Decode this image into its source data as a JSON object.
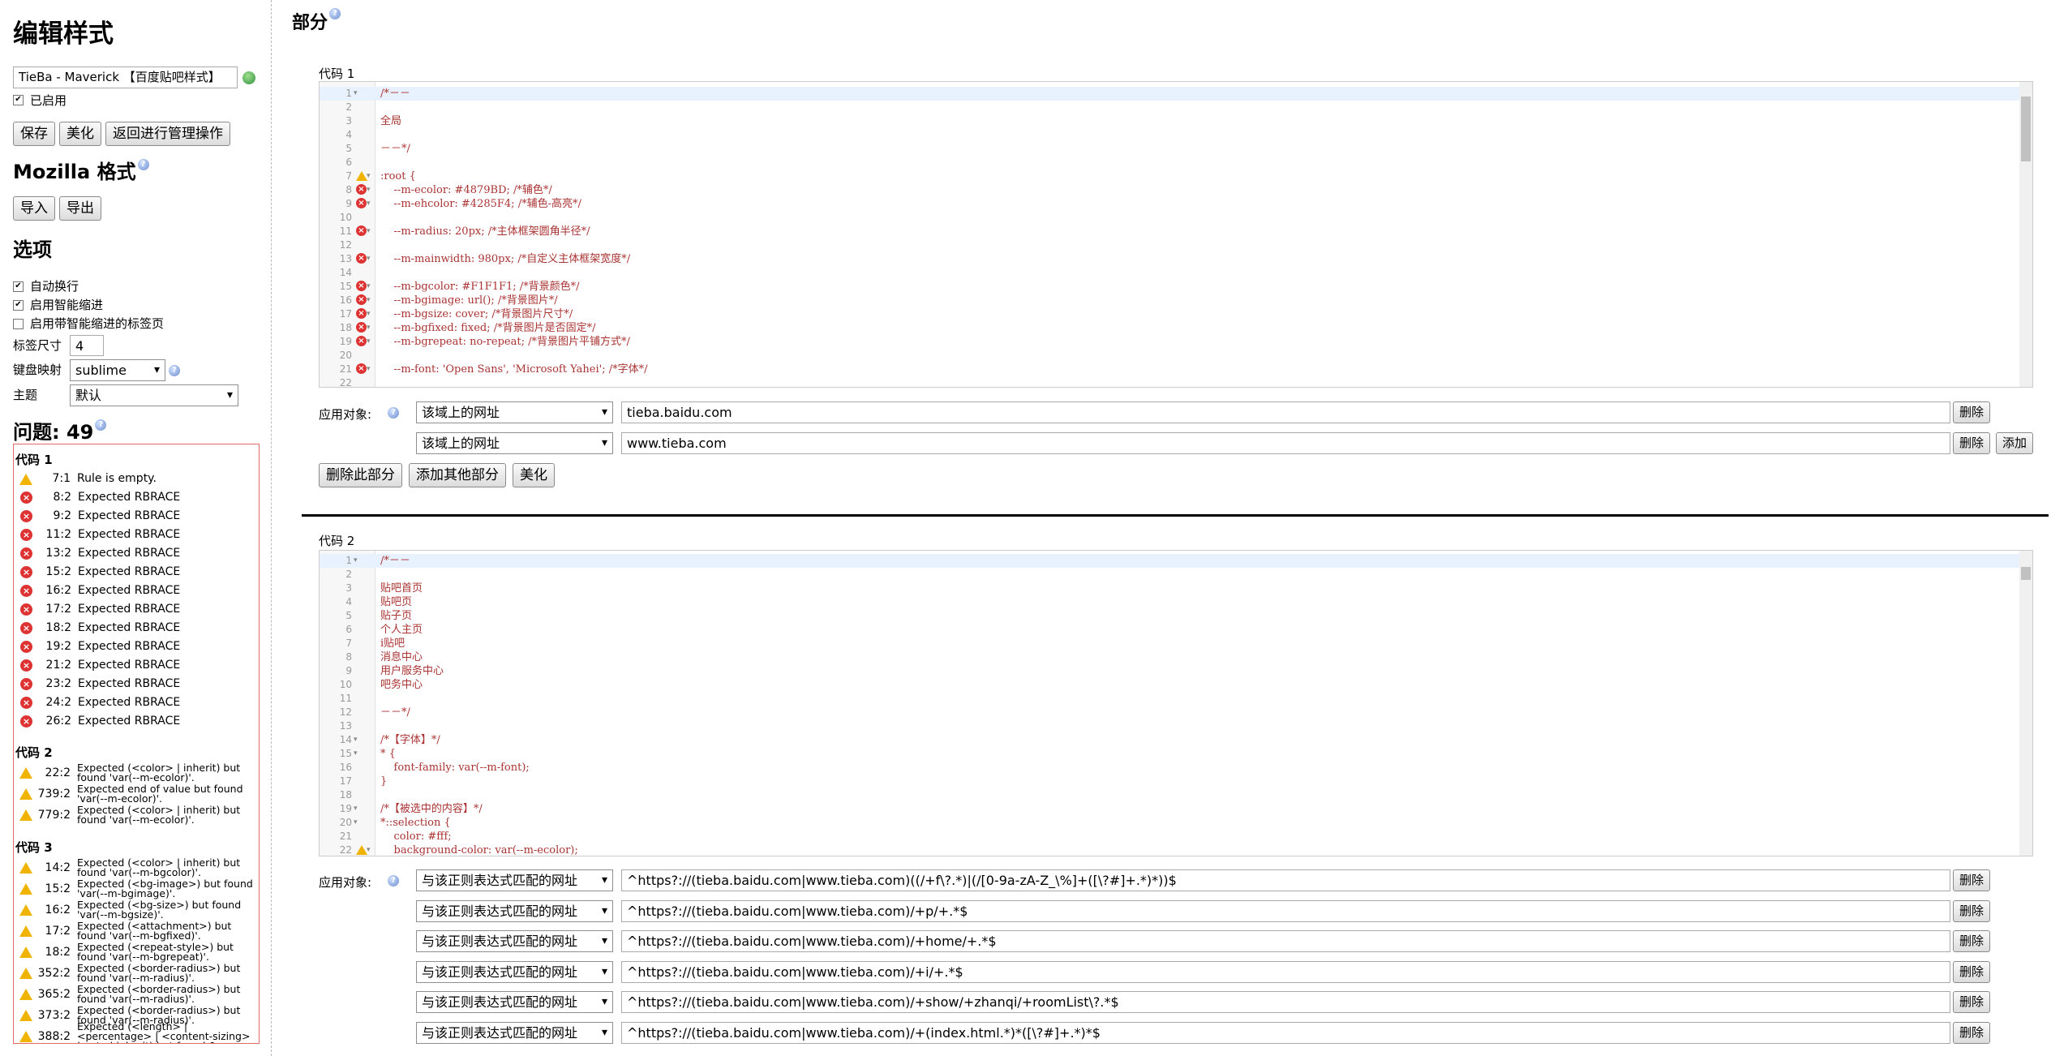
{
  "sidebar": {
    "title": "编辑样式",
    "style_name": "TieBa - Maverick 【百度贴吧样式】",
    "enabled_label": "已启用",
    "buttons": {
      "save": "保存",
      "beautify": "美化",
      "back": "返回进行管理操作"
    },
    "mozilla_heading": "Mozilla 格式",
    "import_label": "导入",
    "export_label": "导出",
    "options_heading": "选项",
    "options": {
      "wrap": "自动换行",
      "smart_indent": "启用智能缩进",
      "smart_indent_tabs": "启用带智能缩进的标签页",
      "tab_size_label": "标签尺寸",
      "tab_size_value": "4",
      "keymap_label": "键盘映射",
      "keymap_value": "sublime",
      "theme_label": "主题",
      "theme_value": "默认"
    },
    "issues_heading": "问题: 49",
    "issue_groups": [
      {
        "title": "代码 1",
        "items": [
          {
            "type": "warn",
            "loc": "7:1",
            "msg": "Rule is empty."
          },
          {
            "type": "err",
            "loc": "8:2",
            "msg": "Expected RBRACE"
          },
          {
            "type": "err",
            "loc": "9:2",
            "msg": "Expected RBRACE"
          },
          {
            "type": "err",
            "loc": "11:2",
            "msg": "Expected RBRACE"
          },
          {
            "type": "err",
            "loc": "13:2",
            "msg": "Expected RBRACE"
          },
          {
            "type": "err",
            "loc": "15:2",
            "msg": "Expected RBRACE"
          },
          {
            "type": "err",
            "loc": "16:2",
            "msg": "Expected RBRACE"
          },
          {
            "type": "err",
            "loc": "17:2",
            "msg": "Expected RBRACE"
          },
          {
            "type": "err",
            "loc": "18:2",
            "msg": "Expected RBRACE"
          },
          {
            "type": "err",
            "loc": "19:2",
            "msg": "Expected RBRACE"
          },
          {
            "type": "err",
            "loc": "21:2",
            "msg": "Expected RBRACE"
          },
          {
            "type": "err",
            "loc": "23:2",
            "msg": "Expected RBRACE"
          },
          {
            "type": "err",
            "loc": "24:2",
            "msg": "Expected RBRACE"
          },
          {
            "type": "err",
            "loc": "26:2",
            "msg": "Expected RBRACE"
          }
        ]
      },
      {
        "title": "代码 2",
        "items": [
          {
            "type": "warn",
            "loc": "22:2",
            "msg": "Expected (<color> | inherit) but found 'var(--m-ecolor)'."
          },
          {
            "type": "warn",
            "loc": "739:2",
            "msg": "Expected end of value but found 'var(--m-ecolor)'."
          },
          {
            "type": "warn",
            "loc": "779:2",
            "msg": "Expected (<color> | inherit) but found 'var(--m-ecolor)'."
          }
        ]
      },
      {
        "title": "代码 3",
        "items": [
          {
            "type": "warn",
            "loc": "14:2",
            "msg": "Expected (<color> | inherit) but found 'var(--m-bgcolor)'."
          },
          {
            "type": "warn",
            "loc": "15:2",
            "msg": "Expected (<bg-image>) but found 'var(--m-bgimage)'."
          },
          {
            "type": "warn",
            "loc": "16:2",
            "msg": "Expected (<bg-size>) but found 'var(--m-bgsize)'."
          },
          {
            "type": "warn",
            "loc": "17:2",
            "msg": "Expected (<attachment>) but found 'var(--m-bgfixed)'."
          },
          {
            "type": "warn",
            "loc": "18:2",
            "msg": "Expected (<repeat-style>) but found 'var(--m-bgrepeat)'."
          },
          {
            "type": "warn",
            "loc": "352:2",
            "msg": "Expected (<border-radius>) but found 'var(--m-radius)'."
          },
          {
            "type": "warn",
            "loc": "365:2",
            "msg": "Expected (<border-radius>) but found 'var(--m-radius)'."
          },
          {
            "type": "warn",
            "loc": "373:2",
            "msg": "Expected (<border-radius>) but found 'var(--m-radius)'."
          },
          {
            "type": "warn",
            "loc": "388:2",
            "msg": "Expected (<length> | <percentage> | <content-sizing> | auto | inherit) but found &..."
          }
        ]
      }
    ]
  },
  "main": {
    "heading": "部分",
    "section1": {
      "label": "代码 1",
      "lines": [
        {
          "n": "1",
          "fold": true,
          "mk": "",
          "text": "/*－－"
        },
        {
          "n": "2",
          "fold": false,
          "mk": "",
          "text": ""
        },
        {
          "n": "3",
          "fold": false,
          "mk": "",
          "text": "全局"
        },
        {
          "n": "4",
          "fold": false,
          "mk": "",
          "text": ""
        },
        {
          "n": "5",
          "fold": false,
          "mk": "",
          "text": "－－*/"
        },
        {
          "n": "6",
          "fold": false,
          "mk": "",
          "text": ""
        },
        {
          "n": "7",
          "fold": true,
          "mk": "warn",
          "text": ":root {"
        },
        {
          "n": "8",
          "fold": true,
          "mk": "err",
          "text": "    --m-ecolor: #4879BD; /*辅色*/"
        },
        {
          "n": "9",
          "fold": true,
          "mk": "err",
          "text": "    --m-ehcolor: #4285F4; /*辅色-高亮*/"
        },
        {
          "n": "10",
          "fold": false,
          "mk": "",
          "text": ""
        },
        {
          "n": "11",
          "fold": true,
          "mk": "err",
          "text": "    --m-radius: 20px; /*主体框架圆角半径*/"
        },
        {
          "n": "12",
          "fold": false,
          "mk": "",
          "text": ""
        },
        {
          "n": "13",
          "fold": true,
          "mk": "err",
          "text": "    --m-mainwidth: 980px; /*自定义主体框架宽度*/"
        },
        {
          "n": "14",
          "fold": false,
          "mk": "",
          "text": ""
        },
        {
          "n": "15",
          "fold": true,
          "mk": "err",
          "text": "    --m-bgcolor: #F1F1F1; /*背景颜色*/"
        },
        {
          "n": "16",
          "fold": true,
          "mk": "err",
          "text": "    --m-bgimage: url(); /*背景图片*/"
        },
        {
          "n": "17",
          "fold": true,
          "mk": "err",
          "text": "    --m-bgsize: cover; /*背景图片尺寸*/"
        },
        {
          "n": "18",
          "fold": true,
          "mk": "err",
          "text": "    --m-bgfixed: fixed; /*背景图片是否固定*/"
        },
        {
          "n": "19",
          "fold": true,
          "mk": "err",
          "text": "    --m-bgrepeat: no-repeat; /*背景图片平铺方式*/"
        },
        {
          "n": "20",
          "fold": false,
          "mk": "",
          "text": ""
        },
        {
          "n": "21",
          "fold": true,
          "mk": "err",
          "text": "    --m-font: 'Open Sans', 'Microsoft Yahei'; /*字体*/"
        },
        {
          "n": "22",
          "fold": false,
          "mk": "",
          "text": ""
        }
      ],
      "apply_label": "应用对象:",
      "rules": [
        {
          "type": "该域上的网址",
          "value": "tieba.baidu.com",
          "add": false
        },
        {
          "type": "该域上的网址",
          "value": "www.tieba.com",
          "add": true
        }
      ],
      "delete_label": "删除",
      "add_label": "添加",
      "buttons": {
        "delete_section": "删除此部分",
        "add_section": "添加其他部分",
        "beautify": "美化"
      }
    },
    "section2": {
      "label": "代码 2",
      "lines": [
        {
          "n": "1",
          "fold": true,
          "mk": "",
          "text": "/*－－"
        },
        {
          "n": "2",
          "fold": false,
          "mk": "",
          "text": ""
        },
        {
          "n": "3",
          "fold": false,
          "mk": "",
          "text": "贴吧首页"
        },
        {
          "n": "4",
          "fold": false,
          "mk": "",
          "text": "贴吧页"
        },
        {
          "n": "5",
          "fold": false,
          "mk": "",
          "text": "贴子页"
        },
        {
          "n": "6",
          "fold": false,
          "mk": "",
          "text": "个人主页"
        },
        {
          "n": "7",
          "fold": false,
          "mk": "",
          "text": "i贴吧"
        },
        {
          "n": "8",
          "fold": false,
          "mk": "",
          "text": "消息中心"
        },
        {
          "n": "9",
          "fold": false,
          "mk": "",
          "text": "用户服务中心"
        },
        {
          "n": "10",
          "fold": false,
          "mk": "",
          "text": "吧务中心"
        },
        {
          "n": "11",
          "fold": false,
          "mk": "",
          "text": ""
        },
        {
          "n": "12",
          "fold": false,
          "mk": "",
          "text": "－－*/"
        },
        {
          "n": "13",
          "fold": false,
          "mk": "",
          "text": ""
        },
        {
          "n": "14",
          "fold": true,
          "mk": "",
          "text": "/*【字体】*/"
        },
        {
          "n": "15",
          "fold": true,
          "mk": "",
          "text": "* {"
        },
        {
          "n": "16",
          "fold": false,
          "mk": "",
          "text": "    font-family: var(--m-font);"
        },
        {
          "n": "17",
          "fold": false,
          "mk": "",
          "text": "}"
        },
        {
          "n": "18",
          "fold": false,
          "mk": "",
          "text": ""
        },
        {
          "n": "19",
          "fold": true,
          "mk": "",
          "text": "/*【被选中的内容】*/"
        },
        {
          "n": "20",
          "fold": true,
          "mk": "",
          "text": "*::selection {"
        },
        {
          "n": "21",
          "fold": false,
          "mk": "",
          "text": "    color: #fff;"
        },
        {
          "n": "22",
          "fold": true,
          "mk": "warn",
          "text": "    background-color: var(--m-ecolor);"
        }
      ],
      "apply_label": "应用对象:",
      "rules": [
        {
          "type": "与该正则表达式匹配的网址",
          "value": "^https?://(tieba.baidu.com|www.tieba.com)((/+f\\?.*)|(/[0-9a-zA-Z_\\%]+([\\?#]+.*)*))$"
        },
        {
          "type": "与该正则表达式匹配的网址",
          "value": "^https?://(tieba.baidu.com|www.tieba.com)/+p/+.*$"
        },
        {
          "type": "与该正则表达式匹配的网址",
          "value": "^https?://(tieba.baidu.com|www.tieba.com)/+home/+.*$"
        },
        {
          "type": "与该正则表达式匹配的网址",
          "value": "^https?://(tieba.baidu.com|www.tieba.com)/+i/+.*$"
        },
        {
          "type": "与该正则表达式匹配的网址",
          "value": "^https?://(tieba.baidu.com|www.tieba.com)/+show/+zhanqi/+roomList\\?.*$"
        },
        {
          "type": "与该正则表达式匹配的网址",
          "value": "^https?://(tieba.baidu.com|www.tieba.com)/+(index.html.*)*([\\?#]+.*)*$"
        }
      ],
      "delete_label": "删除"
    }
  }
}
